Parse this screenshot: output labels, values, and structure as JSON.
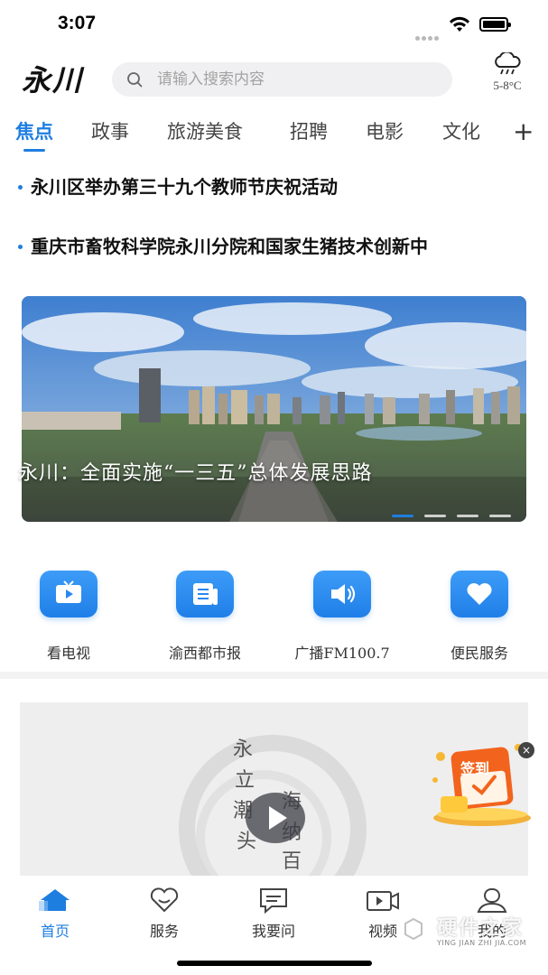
{
  "status_bar": {
    "time": "3:07"
  },
  "header": {
    "logo": "永川",
    "search_placeholder": "请输入搜索内容",
    "weather": {
      "icon": "cloud-rain-icon",
      "temp": "5-8°C"
    }
  },
  "tabs": [
    {
      "label": "焦点",
      "active": true
    },
    {
      "label": "政事"
    },
    {
      "label": "旅游美食"
    },
    {
      "label": "招聘"
    },
    {
      "label": "电影"
    },
    {
      "label": "文化"
    }
  ],
  "tab_add_label": "+",
  "headlines": [
    "永川区举办第三十九个教师节庆祝活动",
    "重庆市畜牧科学院永川分院和国家生猪技术创新中"
  ],
  "banner": {
    "caption": "永川：全面实施“一三五”总体发展思路",
    "slides_total": 4,
    "current_slide": 1
  },
  "quick_services": [
    {
      "label": "看电视",
      "icon": "tv-icon"
    },
    {
      "label": "渝西都市报",
      "icon": "newspaper-icon"
    },
    {
      "label": "广播FM100.7",
      "icon": "radio-speaker-icon"
    },
    {
      "label": "便民服务",
      "icon": "heart-icon"
    }
  ],
  "video_card": {
    "calligraphy": [
      "永",
      "立",
      "潮",
      "头",
      "海",
      "纳",
      "百"
    ]
  },
  "signin_badge": {
    "label": "签到",
    "close": "×"
  },
  "bottom_nav": [
    {
      "label": "首页",
      "icon": "home-icon",
      "active": true
    },
    {
      "label": "服务",
      "icon": "heart-chat-icon"
    },
    {
      "label": "我要问",
      "icon": "message-icon"
    },
    {
      "label": "视频",
      "icon": "video-icon"
    },
    {
      "label": "我的",
      "icon": "user-icon"
    }
  ],
  "watermark": {
    "text": "硬件之家",
    "sub": "YING JIAN ZHI JIA.COM"
  },
  "colors": {
    "accent": "#1e7ee0"
  }
}
